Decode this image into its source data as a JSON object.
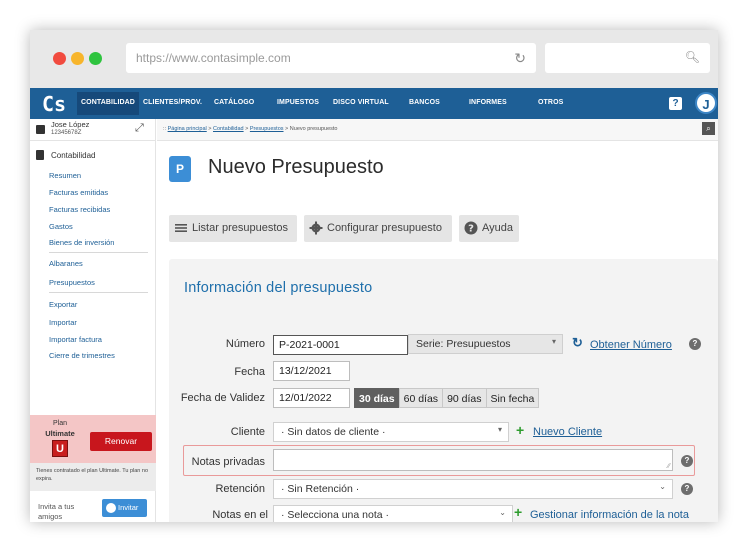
{
  "browser": {
    "url": "https://www.contasimple.com"
  },
  "app": {
    "logo": "Cs",
    "nav": [
      "CONTABILIDAD",
      "CLIENTES/PROV.",
      "CATÁLOGO",
      "IMPUESTOS",
      "DISCO VIRTUAL",
      "BANCOS",
      "INFORMES",
      "OTROS"
    ],
    "help_label": "?",
    "avatar_initial": "J"
  },
  "sidebar": {
    "user_name": "Jose López",
    "user_id": "12345678Z",
    "section_title": "Contabilidad",
    "group1": [
      "Resumen",
      "Facturas emitidas",
      "Facturas recibidas",
      "Gastos",
      "Bienes de inversión"
    ],
    "group2": [
      "Albaranes",
      "Presupuestos"
    ],
    "group3": [
      "Exportar",
      "Importar",
      "Importar factura",
      "Cierre de trimestres"
    ],
    "plan_label": "Plan",
    "plan_name": "Ultimate",
    "plan_badge": "U",
    "renew_label": "Renovar",
    "plan_note": "Tienes contratado el plan Ultimate. Tu plan no expira.",
    "invite_text_1": "Invita a tus",
    "invite_text_2": "amigos",
    "invite_button": "Invitar"
  },
  "breadcrumb": {
    "prefix": "::",
    "items": [
      "Página principal",
      "Contabilidad",
      "Presupuestos"
    ],
    "current": "Nuevo presupuesto",
    "separator": ">"
  },
  "page": {
    "title": "Nuevo Presupuesto",
    "title_icon_letter": "P",
    "toolbar": {
      "list": "Listar presupuestos",
      "config": "Configurar presupuesto",
      "help": "Ayuda"
    }
  },
  "form": {
    "section_title": "Información del presupuesto",
    "numero_label": "Número",
    "numero_value": "P-2021-0001",
    "serie_value": "Serie: Presupuestos",
    "obtener_numero": "Obtener Número",
    "fecha_label": "Fecha",
    "fecha_value": "13/12/2021",
    "validez_label": "Fecha de Validez",
    "validez_value": "12/01/2022",
    "validez_options": [
      "30 días",
      "60 días",
      "90 días",
      "Sin fecha"
    ],
    "validez_selected": "30 días",
    "cliente_label": "Cliente",
    "cliente_value": "· Sin datos de cliente ·",
    "nuevo_cliente": "Nuevo Cliente",
    "notas_privadas_label": "Notas privadas",
    "retencion_label": "Retención",
    "retencion_value": "· Sin Retención ·",
    "notas_label": "Notas en el",
    "notas_value": "· Selecciona una nota ·",
    "gestionar_notas": "Gestionar información de la nota"
  },
  "colors": {
    "nav_bg": "#1e5f96",
    "accent_blue": "#3c8ed6",
    "renew_red": "#c8161d",
    "plan_bg": "#f4c6c6"
  }
}
